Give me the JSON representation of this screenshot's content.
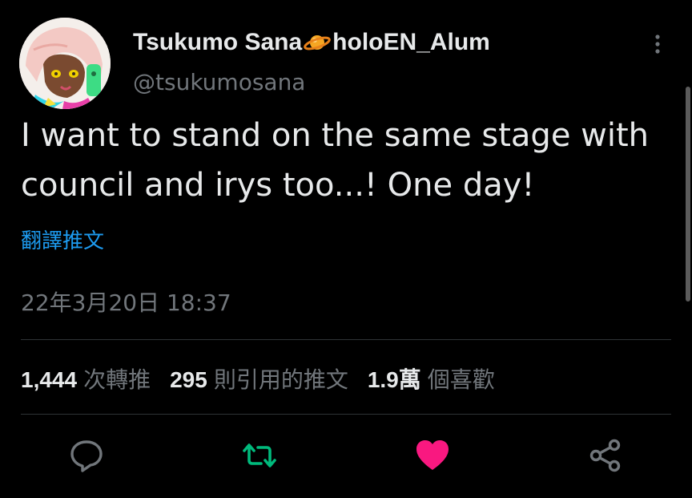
{
  "author": {
    "display_name_prefix": "Tsukumo Sana",
    "display_name_emoji": "planet-emoji",
    "display_name_suffix": "holoEN_Alum",
    "handle": "@tsukumosana"
  },
  "tweet": {
    "text": "I want to stand on the same stage with council and irys too...! One day!",
    "translate_label": "翻譯推文",
    "timestamp": "22年3月20日 18:37"
  },
  "stats": {
    "retweets_count": "1,444",
    "retweets_label": "次轉推",
    "quotes_count": "295",
    "quotes_label": "則引用的推文",
    "likes_count": "1.9萬",
    "likes_label": "個喜歡"
  },
  "actions": {
    "reply_icon": "speech-bubble-icon",
    "retweet_icon": "retweet-arrows-icon",
    "like_icon": "heart-icon",
    "share_icon": "share-nodes-icon",
    "liked": true
  },
  "colors": {
    "background": "#000000",
    "text_primary": "#e7e9ea",
    "text_secondary": "#71767b",
    "link": "#1d9bf0",
    "retweet_green": "#00ba7c",
    "like_pink": "#f91880",
    "divider": "#2f3336"
  }
}
